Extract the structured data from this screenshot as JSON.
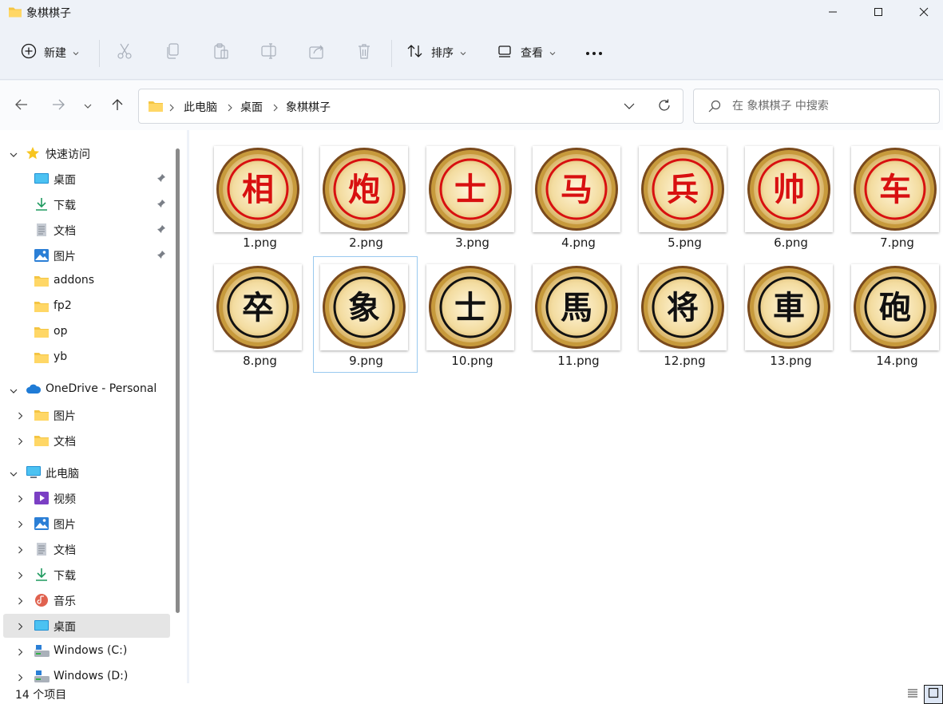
{
  "window": {
    "title": "象棋棋子",
    "controls": [
      "minimize",
      "maximize",
      "close"
    ]
  },
  "toolbar": {
    "new_label": "新建",
    "sort_label": "排序",
    "view_label": "查看",
    "more_label": "•••"
  },
  "address": {
    "crumbs": [
      "此电脑",
      "桌面",
      "象棋棋子"
    ]
  },
  "search": {
    "placeholder": "在 象棋棋子 中搜索"
  },
  "sidebar": {
    "quick_access": "快速访问",
    "quick_items": [
      "桌面",
      "下载",
      "文档",
      "图片",
      "addons",
      "fp2",
      "op",
      "yb"
    ],
    "onedrive": "OneDrive - Personal",
    "onedrive_items": [
      "图片",
      "文档"
    ],
    "this_pc": "此电脑",
    "pc_items": [
      "视频",
      "图片",
      "文档",
      "下载",
      "音乐",
      "桌面",
      "Windows (C:)",
      "Windows (D:)"
    ]
  },
  "files": [
    {
      "name": "1.png",
      "glyph": "相",
      "side": "red"
    },
    {
      "name": "2.png",
      "glyph": "炮",
      "side": "red"
    },
    {
      "name": "3.png",
      "glyph": "士",
      "side": "red"
    },
    {
      "name": "4.png",
      "glyph": "马",
      "side": "red"
    },
    {
      "name": "5.png",
      "glyph": "兵",
      "side": "red"
    },
    {
      "name": "6.png",
      "glyph": "帅",
      "side": "red"
    },
    {
      "name": "7.png",
      "glyph": "车",
      "side": "red"
    },
    {
      "name": "8.png",
      "glyph": "卒",
      "side": "black"
    },
    {
      "name": "9.png",
      "glyph": "象",
      "side": "black"
    },
    {
      "name": "10.png",
      "glyph": "士",
      "side": "black"
    },
    {
      "name": "11.png",
      "glyph": "馬",
      "side": "black"
    },
    {
      "name": "12.png",
      "glyph": "将",
      "side": "black"
    },
    {
      "name": "13.png",
      "glyph": "車",
      "side": "black"
    },
    {
      "name": "14.png",
      "glyph": "砲",
      "side": "black"
    }
  ],
  "status": {
    "item_count": "14 个项目"
  },
  "colors": {
    "chrome_bg": "#eef2f8",
    "accent": "#0067c0",
    "folder_yellow": "#f4c543",
    "piece_red": "#d81010",
    "piece_black": "#111111",
    "piece_face": "#f3dca0",
    "piece_rim": "#c79a3c",
    "selection_border": "#99c9ef"
  }
}
